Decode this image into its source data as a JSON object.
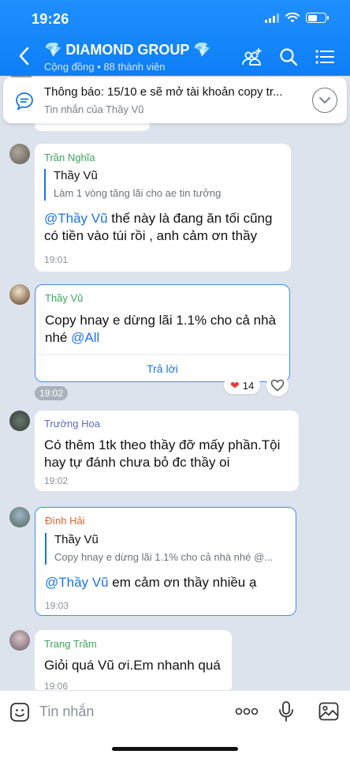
{
  "status": {
    "time": "19:26"
  },
  "header": {
    "title": "💎 DIAMOND GROUP 💎",
    "subtitle": "Cộng đồng • 88 thành viên"
  },
  "pinned": {
    "title": "Thông báo: 15/10 e sẽ mở tài khoản copy tr...",
    "subtitle": "Tin nhắn của Thầy Vũ"
  },
  "messages": [
    {
      "sender": "Trần Nghĩa",
      "sender_color": "#3aa65a",
      "quote_author": "Thầy Vũ",
      "quote_text": "Làm 1 vòng tăng lãi cho ae tin tưởng",
      "mention": "@Thầy Vũ",
      "text": " thế này là đang ăn tối cũng có tiền vào túi rồi , anh cảm ơn thầy",
      "time": "19:01"
    },
    {
      "sender": "Thầy Vũ",
      "sender_color": "#3aa65a",
      "text": "Copy hnay e dừng lãi 1.1% cho cả nhà nhé ",
      "mention": "@All",
      "reply_label": "Trả lời",
      "time": "19:02",
      "reaction_count": "14"
    },
    {
      "sender": "Trường Hoa",
      "sender_color": "#5c6bc0",
      "text": "Có thêm 1tk theo thầy đỡ mấy phần.Tội hay tự đánh chưa bỏ đc thầy oi",
      "time": "19:02"
    },
    {
      "sender": "Đình Hải",
      "sender_color": "#e0622f",
      "quote_author": "Thầy Vũ",
      "quote_text": "Copy hnay e dừng lãi 1.1% cho cả nhà nhé @...",
      "mention": "@Thầy Vũ",
      "text": " em cảm ơn thầy nhiều ạ",
      "time": "19:03"
    },
    {
      "sender": "Trang Trầm",
      "sender_color": "#3aa65a",
      "text": "Giỏi quá Vũ ơi.Em nhanh quá",
      "time": "19:06"
    }
  ],
  "input": {
    "placeholder": "Tin nhắn"
  }
}
